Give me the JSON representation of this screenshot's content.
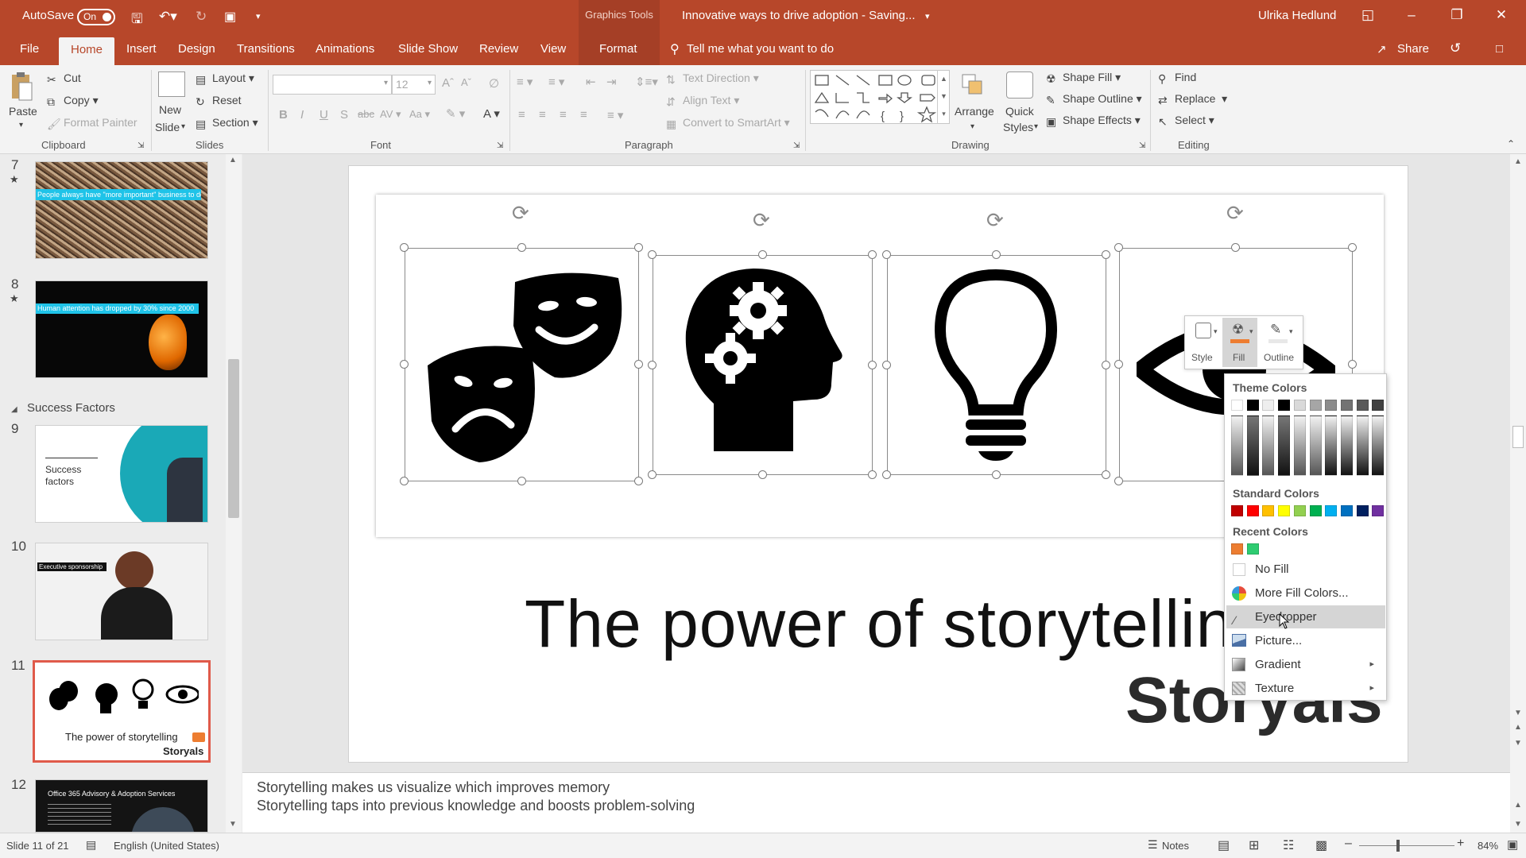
{
  "titlebar": {
    "autosave_label": "AutoSave",
    "autosave_state": "On",
    "contextual_group": "Graphics Tools",
    "doc_title": "Innovative ways to drive adoption  -  Saving...",
    "user": "Ulrika Hedlund"
  },
  "tabs": [
    "File",
    "Home",
    "Insert",
    "Design",
    "Transitions",
    "Animations",
    "Slide Show",
    "Review",
    "View",
    "Format"
  ],
  "active_tab": "Home",
  "tell_me": "Tell me what you want to do",
  "share_label": "Share",
  "ribbon": {
    "clipboard": {
      "paste": "Paste",
      "cut": "Cut",
      "copy": "Copy",
      "format_painter": "Format Painter",
      "group": "Clipboard"
    },
    "slides": {
      "new_slide_1": "New",
      "new_slide_2": "Slide",
      "layout": "Layout",
      "reset": "Reset",
      "section": "Section",
      "group": "Slides"
    },
    "font": {
      "size": "12",
      "group": "Font"
    },
    "paragraph": {
      "text_direction": "Text Direction",
      "align_text": "Align Text",
      "smartart": "Convert to SmartArt",
      "group": "Paragraph"
    },
    "drawing": {
      "arrange": "Arrange",
      "quick_1": "Quick",
      "quick_2": "Styles",
      "shape_fill": "Shape Fill",
      "shape_outline": "Shape Outline",
      "shape_effects": "Shape Effects",
      "group": "Drawing"
    },
    "editing": {
      "find": "Find",
      "replace": "Replace",
      "select": "Select",
      "group": "Editing"
    }
  },
  "slides_pane": {
    "section": "Success Factors",
    "slides": [
      {
        "num": "7",
        "caption": "People always have \"more important\" business to do"
      },
      {
        "num": "8",
        "caption": "Human attention has dropped by 30% since 2000"
      },
      {
        "num": "9",
        "caption_1": "Success",
        "caption_2": "factors"
      },
      {
        "num": "10",
        "caption": "Executive sponsorship"
      },
      {
        "num": "11",
        "caption": "The power of storytelling",
        "brand": "Storyals"
      },
      {
        "num": "12",
        "caption": "Office 365 Advisory & Adoption Services"
      }
    ]
  },
  "slide": {
    "title": "The power of storytelling",
    "brand": "Storyals"
  },
  "notes": [
    "Storytelling makes us visualize which improves memory",
    "Storytelling taps into previous knowledge and boosts problem-solving"
  ],
  "mini_toolbar": {
    "style": "Style",
    "fill": "Fill",
    "outline": "Outline"
  },
  "fill_menu": {
    "theme_header": "Theme Colors",
    "standard_header": "Standard Colors",
    "recent_header": "Recent Colors",
    "no_fill": "No Fill",
    "more_colors": "More Fill Colors...",
    "eyedropper": "Eyedropper",
    "picture": "Picture...",
    "gradient": "Gradient",
    "texture": "Texture",
    "theme_colors": [
      "#ffffff",
      "#000000",
      "#eeeeee",
      "#000000",
      "#d9d9d9",
      "#a6a6a6",
      "#8c8c8c",
      "#737373",
      "#595959",
      "#404040"
    ],
    "standard_colors": [
      "#c00000",
      "#ff0000",
      "#ffc000",
      "#ffff00",
      "#92d050",
      "#00b050",
      "#00b0f0",
      "#0070c0",
      "#002060",
      "#7030a0"
    ],
    "recent_colors": [
      "#ed7d31",
      "#2ecc71"
    ]
  },
  "status": {
    "slide_info": "Slide 11 of 21",
    "language": "English (United States)",
    "notes": "Notes",
    "zoom": "84%"
  },
  "colors": {
    "accent": "#b7472a",
    "selection": "#e05a4a"
  }
}
